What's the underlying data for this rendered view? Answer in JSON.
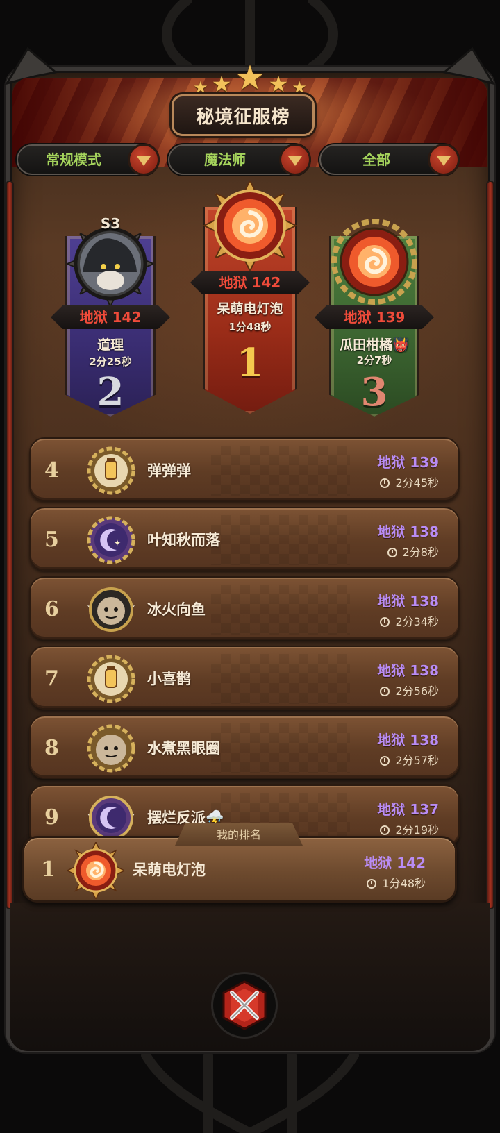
{
  "header": {
    "title": "秘境征服榜",
    "star_count": 5
  },
  "filters": [
    {
      "label": "常规模式"
    },
    {
      "label": "魔法师"
    },
    {
      "label": "全部"
    }
  ],
  "podium": {
    "first": {
      "rank": "1",
      "score": "地狱 142",
      "name": "呆萌电灯泡",
      "time": "1分48秒",
      "icon": "fire-swirl-icon",
      "color": "#b0321f"
    },
    "second": {
      "rank": "2",
      "season_badge": "S3",
      "score": "地狱 142",
      "name": "道理",
      "time": "2分25秒",
      "icon": "hooded-cat-avatar",
      "color": "#4b3a8c"
    },
    "third": {
      "rank": "3",
      "score": "地狱 139",
      "name": "瓜田柑橘",
      "name_emoji": "👹",
      "time": "2分7秒",
      "icon": "fire-swirl-icon",
      "color": "#3e6e33"
    }
  },
  "ranking": [
    {
      "rank": "4",
      "name": "弹弹弹",
      "score": "地狱 139",
      "time": "2分45秒",
      "icon": "lantern-icon"
    },
    {
      "rank": "5",
      "name": "叶知秋而落",
      "score": "地狱 138",
      "time": "2分8秒",
      "icon": "moon-star-icon"
    },
    {
      "rank": "6",
      "name": "冰火向鱼",
      "score": "地狱 138",
      "time": "2分34秒",
      "icon": "goblin-face-icon"
    },
    {
      "rank": "7",
      "name": "小喜鹊",
      "score": "地狱 138",
      "time": "2分56秒",
      "icon": "lantern-icon"
    },
    {
      "rank": "8",
      "name": "水煮黑眼圈",
      "score": "地狱 138",
      "time": "2分57秒",
      "icon": "goblin-face-icon"
    },
    {
      "rank": "9",
      "name": "摆烂反派⛈️",
      "score": "地狱 137",
      "time": "2分19秒",
      "icon": "moon-star-icon"
    }
  ],
  "my_rank": {
    "tag": "我的排名",
    "rank": "1",
    "name": "呆萌电灯泡",
    "score": "地狱 142",
    "time": "1分48秒",
    "icon": "fire-swirl-icon"
  },
  "colors": {
    "score_red": "#f04b3a",
    "score_purple": "#b98cf4",
    "filter_green": "#a5d45c",
    "gold": "#f2c15a"
  }
}
